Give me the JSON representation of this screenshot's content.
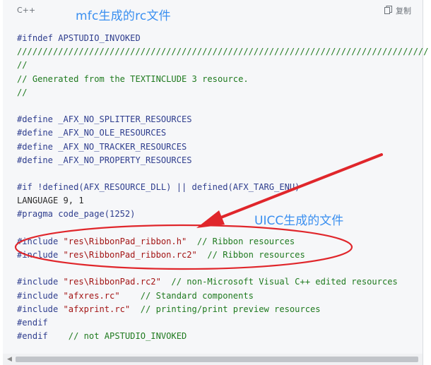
{
  "header": {
    "language": "C++",
    "copy_label": "复制"
  },
  "annotations": {
    "top_label": "mfc生成的rc文件",
    "arrow_label": "UICC生成的文件"
  },
  "code_lines": [
    [
      {
        "t": "#ifndef APSTUDIO_INVOKED",
        "c": "directive"
      }
    ],
    [
      {
        "t": "////////////////////////////////////////////////////////////////////////////////",
        "c": "comment"
      }
    ],
    [
      {
        "t": "//",
        "c": "comment"
      }
    ],
    [
      {
        "t": "// Generated from the TEXTINCLUDE 3 resource.",
        "c": "comment"
      }
    ],
    [
      {
        "t": "//",
        "c": "comment"
      }
    ],
    [
      {
        "t": "",
        "c": "plain"
      }
    ],
    [
      {
        "t": "#define _AFX_NO_SPLITTER_RESOURCES",
        "c": "directive"
      }
    ],
    [
      {
        "t": "#define _AFX_NO_OLE_RESOURCES",
        "c": "directive"
      }
    ],
    [
      {
        "t": "#define _AFX_NO_TRACKER_RESOURCES",
        "c": "directive"
      }
    ],
    [
      {
        "t": "#define _AFX_NO_PROPERTY_RESOURCES",
        "c": "directive"
      }
    ],
    [
      {
        "t": "",
        "c": "plain"
      }
    ],
    [
      {
        "t": "#if !defined(AFX_RESOURCE_DLL) || defined(AFX_TARG_ENU)",
        "c": "directive"
      }
    ],
    [
      {
        "t": "LANGUAGE 9, 1",
        "c": "plain"
      }
    ],
    [
      {
        "t": "#pragma code_page(1252)",
        "c": "directive"
      }
    ],
    [
      {
        "t": "",
        "c": "plain"
      }
    ],
    [
      {
        "t": "#include ",
        "c": "directive"
      },
      {
        "t": "\"res\\RibbonPad_ribbon.h\"",
        "c": "str"
      },
      {
        "t": "  // Ribbon resources",
        "c": "comment"
      }
    ],
    [
      {
        "t": "#include ",
        "c": "directive"
      },
      {
        "t": "\"res\\RibbonPad_ribbon.rc2\"",
        "c": "str"
      },
      {
        "t": "  // Ribbon resources",
        "c": "comment"
      }
    ],
    [
      {
        "t": "",
        "c": "plain"
      }
    ],
    [
      {
        "t": "#include ",
        "c": "directive"
      },
      {
        "t": "\"res\\RibbonPad.rc2\"",
        "c": "str"
      },
      {
        "t": "  // non-Microsoft Visual C++ edited resources",
        "c": "comment"
      }
    ],
    [
      {
        "t": "#include ",
        "c": "directive"
      },
      {
        "t": "\"afxres.rc\"",
        "c": "str"
      },
      {
        "t": "    // Standard components",
        "c": "comment"
      }
    ],
    [
      {
        "t": "#include ",
        "c": "directive"
      },
      {
        "t": "\"afxprint.rc\"",
        "c": "str"
      },
      {
        "t": "  // printing/print preview resources",
        "c": "comment"
      }
    ],
    [
      {
        "t": "#endif",
        "c": "directive"
      }
    ],
    [
      {
        "t": "#endif",
        "c": "directive"
      },
      {
        "t": "    // not APSTUDIO_INVOKED",
        "c": "comment"
      }
    ]
  ],
  "colors": {
    "annotation_blue": "#3a8ff0",
    "annotation_red": "#e0262b"
  }
}
